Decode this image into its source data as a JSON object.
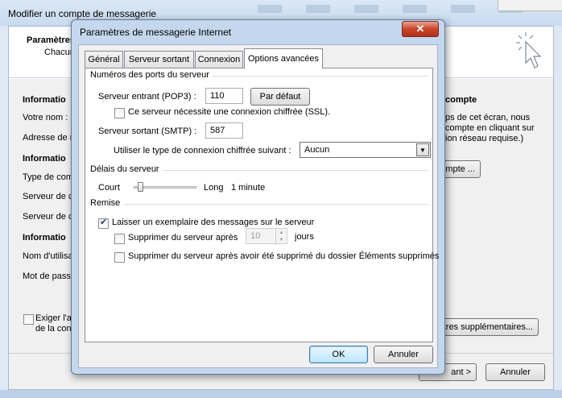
{
  "background_window": {
    "title": "Modifier un compte de messagerie",
    "header_title": "Paramètres",
    "header_subtitle": "Chacun",
    "labels": {
      "info1": "Informatio",
      "votre_nom": "Votre nom :",
      "adresse": "Adresse de m",
      "info2": "Informatio",
      "type": "Type de comp",
      "serveur1": "Serveur de c",
      "serveur2": "Serveur de c",
      "info3": "Informatio",
      "nom_util": "Nom d'utilisa",
      "mot_passe": "Mot de passe",
      "exiger1": "Exiger l'au",
      "exiger2": "de la conn"
    },
    "right_panel": {
      "heading": "compte",
      "line1": "ps de cet écran, nous",
      "line2": "compte en cliquant sur",
      "line3": "ion réseau requise.)",
      "btn_partial": "mpte ...",
      "btn_params": "tres supplémentaires..."
    },
    "buttons": {
      "next": "ant >",
      "cancel": "Annuler"
    }
  },
  "dialog": {
    "title": "Paramètres de messagerie Internet",
    "close_label": "✕",
    "tabs": [
      "Général",
      "Serveur sortant",
      "Connexion",
      "Options avancées"
    ],
    "active_tab": "Options avancées",
    "ports": {
      "group_title": "Numéros des ports du serveur",
      "incoming_label": "Serveur entrant (POP3) :",
      "incoming_value": "110",
      "default_button": "Par défaut",
      "ssl_label": "Ce serveur nécessite une connexion chiffrée (SSL).",
      "outgoing_label": "Serveur sortant (SMTP) :",
      "outgoing_value": "587",
      "encryption_label": "Utiliser le type de connexion chiffrée suivant :",
      "encryption_value": "Aucun"
    },
    "timeout": {
      "group_title": "Délais du serveur",
      "short_label": "Court",
      "long_label": "Long",
      "value": "1 minute"
    },
    "delivery": {
      "group_title": "Remise",
      "leave_copy_label": "Laisser un exemplaire des messages sur le serveur",
      "leave_copy_checked": true,
      "remove_after_label": "Supprimer du serveur après",
      "remove_after_value": "10",
      "days_label": "jours",
      "remove_deleted_label": "Supprimer du serveur après avoir été supprimé du dossier Éléments supprimés"
    },
    "buttons": {
      "ok": "OK",
      "cancel": "Annuler"
    }
  },
  "colors": {
    "dialog_frame": "#c4d7ec",
    "close_button": "#c9452a",
    "default_button_border": "#3c7fb1"
  }
}
